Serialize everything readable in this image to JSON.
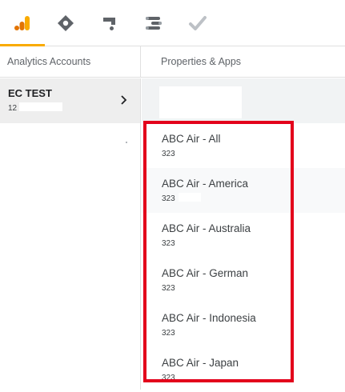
{
  "top_nav": {
    "tabs": [
      {
        "name": "analytics-icon",
        "active": true,
        "color": "#f9ab00"
      },
      {
        "name": "tag-manager-icon",
        "active": false
      },
      {
        "name": "optimize-icon",
        "active": false
      },
      {
        "name": "data-studio-icon",
        "active": false
      },
      {
        "name": "surveys-icon",
        "active": false
      }
    ]
  },
  "columns": {
    "accounts_header": "Analytics Accounts",
    "properties_header": "Properties & Apps"
  },
  "account": {
    "name": "EC TEST",
    "id": "12"
  },
  "properties": [
    {
      "name": "ABC Air - All",
      "id": "323"
    },
    {
      "name": "ABC Air - America",
      "id": "323"
    },
    {
      "name": "ABC Air - Australia",
      "id": "323"
    },
    {
      "name": "ABC Air - German",
      "id": "323"
    },
    {
      "name": "ABC Air - Indonesia",
      "id": "323"
    },
    {
      "name": "ABC Air - Japan",
      "id": "323"
    }
  ],
  "colors": {
    "highlight_border": "#e3001b",
    "active_tab_accent": "#f9ab00",
    "selected_row_bg": "#eeeeee"
  }
}
